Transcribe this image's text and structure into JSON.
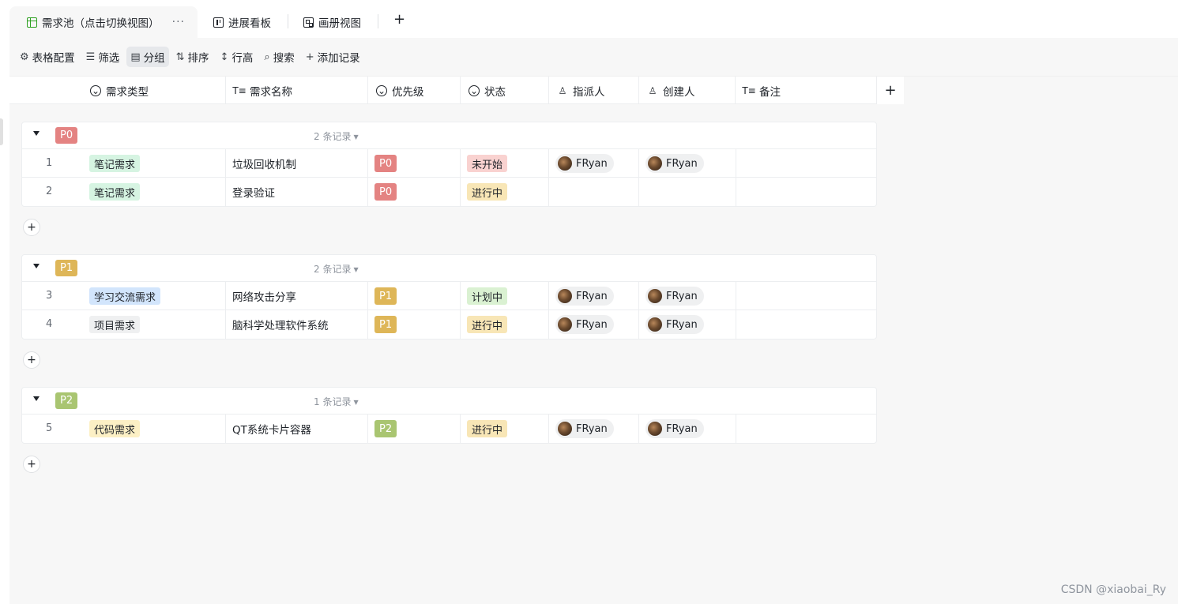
{
  "tabs": [
    {
      "label": "需求池（点击切换视图）",
      "more": "···",
      "icon": "table-icon"
    },
    {
      "label": "进展看板",
      "icon": "kanban-icon"
    },
    {
      "label": "画册视图",
      "icon": "gallery-icon"
    }
  ],
  "tab_add": "+",
  "toolbar": {
    "config": "表格配置",
    "filter": "筛选",
    "group": "分组",
    "sort": "排序",
    "row_height": "行高",
    "search": "搜索",
    "add_record": "添加记录"
  },
  "columns": {
    "type": "需求类型",
    "name": "需求名称",
    "priority": "优先级",
    "status": "状态",
    "assignee": "指派人",
    "creator": "创建人",
    "note": "备注"
  },
  "add_column": "+",
  "colors": {
    "P0": "#e48382",
    "P1": "#deb658",
    "P2": "#a9c571",
    "tag_note": "#d6f4e2",
    "tag_study": "#d2e5fc",
    "tag_project": "#eff0f1",
    "tag_code": "#fcf0c5",
    "status_notstarted": "#f9d2d0",
    "status_inprogress": "#f8e6b6",
    "status_planned": "#daf1d2"
  },
  "groups": [
    {
      "badge": "P0",
      "count": "2 条记录",
      "rows": [
        {
          "num": "1",
          "type": "笔记需求",
          "name": "垃圾回收机制",
          "priority": "P0",
          "status": "未开始",
          "assignee": "FRyan",
          "creator": "FRyan"
        },
        {
          "num": "2",
          "type": "笔记需求",
          "name": "登录验证",
          "priority": "P0",
          "status": "进行中",
          "assignee": "",
          "creator": ""
        }
      ]
    },
    {
      "badge": "P1",
      "count": "2 条记录",
      "rows": [
        {
          "num": "3",
          "type": "学习交流需求",
          "name": "网络攻击分享",
          "priority": "P1",
          "status": "计划中",
          "assignee": "FRyan",
          "creator": "FRyan"
        },
        {
          "num": "4",
          "type": "项目需求",
          "name": "脑科学处理软件系统",
          "priority": "P1",
          "status": "进行中",
          "assignee": "FRyan",
          "creator": "FRyan"
        }
      ]
    },
    {
      "badge": "P2",
      "count": "1 条记录",
      "rows": [
        {
          "num": "5",
          "type": "代码需求",
          "name": "QT系统卡片容器",
          "priority": "P2",
          "status": "进行中",
          "assignee": "FRyan",
          "creator": "FRyan"
        }
      ]
    }
  ],
  "add_row": "+",
  "watermark": "CSDN @xiaobai_Ry"
}
